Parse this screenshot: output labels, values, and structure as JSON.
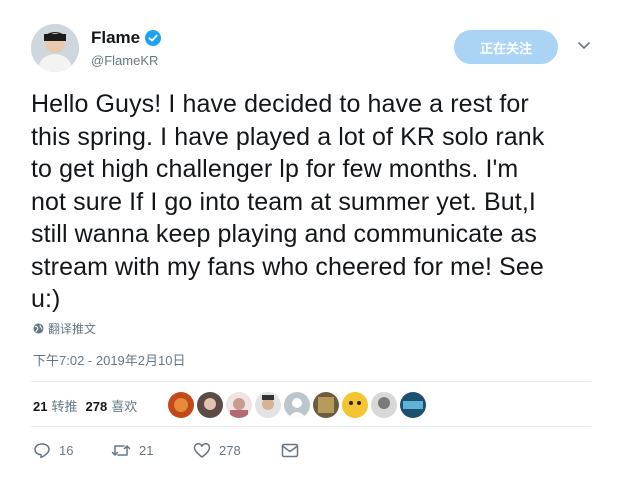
{
  "user": {
    "display_name": "Flame",
    "handle": "@FlameKR",
    "verified": true,
    "avatar_icon": "user-avatar"
  },
  "header": {
    "follow_button_label": "正在关注",
    "more_icon": "chevron-down-icon"
  },
  "tweet": {
    "lines": [
      "Hello Guys! I have decided to have a rest for",
      "this spring. I have played a lot of KR solo rank",
      "to get high challenger lp for few months. I'm",
      "not sure If I go into team at summer yet. But,I",
      "still wanna keep playing and communicate as",
      "stream with my fans who cheered for me! See",
      "u:)"
    ],
    "translate_label": "翻译推文",
    "timestamp": "下午7:02 - 2019年2月10日"
  },
  "stats": {
    "retweets_count": "21",
    "retweets_label": "转推",
    "likes_count": "278",
    "likes_label": "喜欢"
  },
  "actions": {
    "reply_count": "16",
    "retweet_count": "21",
    "like_count": "278"
  },
  "colors": {
    "accent": "#1da1f2",
    "follow_button_bg": "#a9d4f5",
    "muted_text": "#657786",
    "divider": "#e6ecf0"
  }
}
